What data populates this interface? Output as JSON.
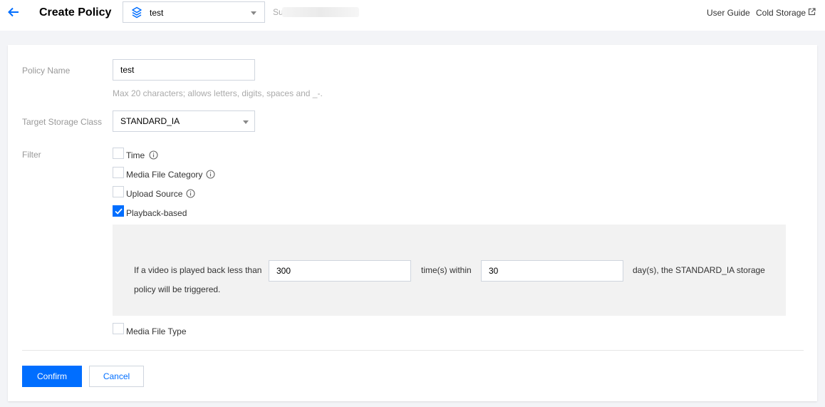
{
  "header": {
    "title": "Create Policy",
    "project_select": {
      "value": "test"
    },
    "sub_label": "Su",
    "links": {
      "user_guide": "User Guide",
      "cold_storage": "Cold Storage"
    }
  },
  "form": {
    "policy_name": {
      "label": "Policy Name",
      "value": "test",
      "hint": "Max 20 characters; allows letters, digits, spaces and _-."
    },
    "target_storage_class": {
      "label": "Target Storage Class",
      "value": "STANDARD_IA"
    },
    "filter": {
      "label": "Filter",
      "options": [
        {
          "label": "Time",
          "checked": false,
          "info": true
        },
        {
          "label": "Media File Category",
          "checked": false,
          "info": true
        },
        {
          "label": "Upload Source",
          "checked": false,
          "info": true
        },
        {
          "label": "Playback-based",
          "checked": true,
          "info": false
        }
      ],
      "playback": {
        "text_before": "If a video is played back less than",
        "times_value": "300",
        "text_middle": "time(s) within",
        "days_value": "30",
        "text_after": "day(s), the STANDARD_IA storage",
        "text_line2": "policy will be triggered."
      },
      "media_file_type": {
        "label": "Media File Type",
        "checked": false
      }
    }
  },
  "actions": {
    "confirm": "Confirm",
    "cancel": "Cancel"
  },
  "colors": {
    "accent": "#006eff",
    "background": "#f3f4f7"
  }
}
